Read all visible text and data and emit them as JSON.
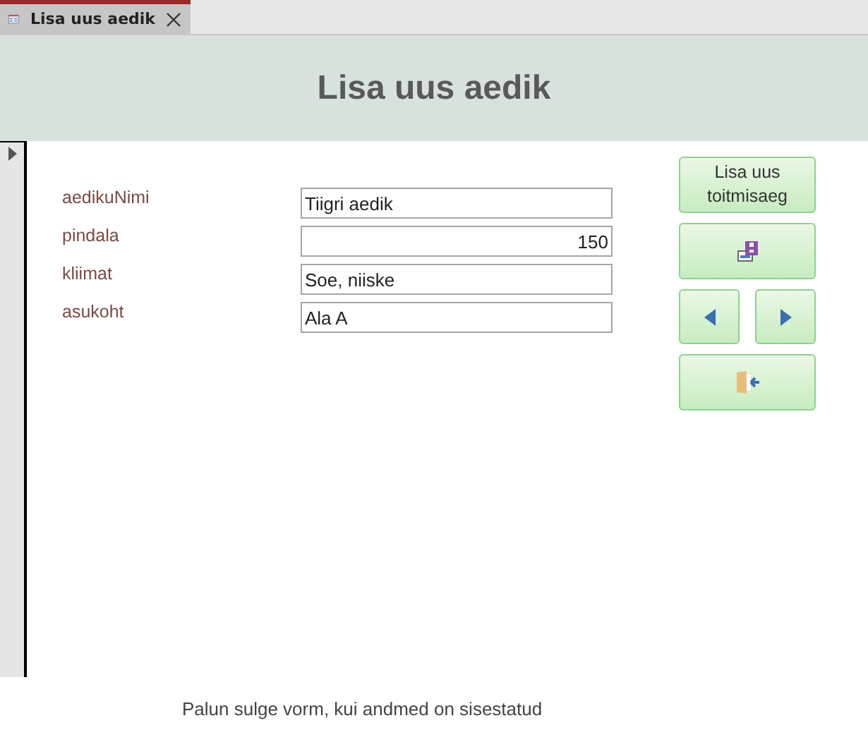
{
  "tab": {
    "title": "Lisa uus aedik",
    "selected": true
  },
  "header": {
    "title": "Lisa uus aedik"
  },
  "fields": [
    {
      "label": "aedikuNimi",
      "value": "Tiigri aedik",
      "kind": "text"
    },
    {
      "label": "pindala",
      "value": "150",
      "kind": "number"
    },
    {
      "label": "kliimat",
      "value": "Soe, niiske",
      "kind": "text"
    },
    {
      "label": "asukoht",
      "value": "Ala A",
      "kind": "text"
    }
  ],
  "buttons": [
    {
      "kind": "text",
      "label": "Lisa uus toitmisaeg"
    },
    {
      "kind": "save"
    },
    {
      "kind": "previous"
    },
    {
      "kind": "next"
    },
    {
      "kind": "exit"
    }
  ],
  "footer": "Palun sulge vorm, kui andmed on sisestatud"
}
